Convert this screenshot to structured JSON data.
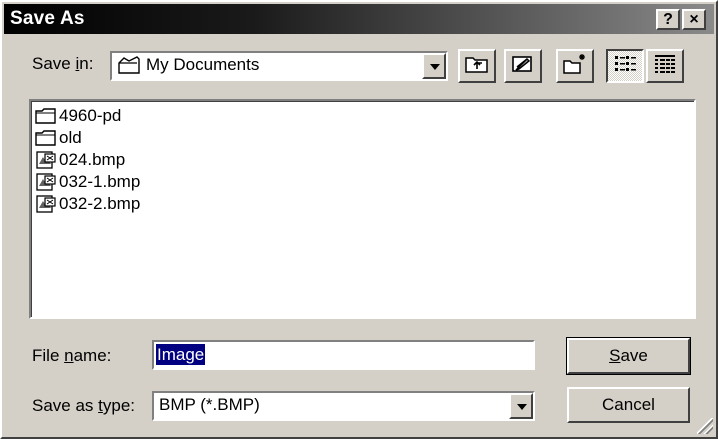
{
  "window": {
    "title": "Save As"
  },
  "titlebar": {
    "help_label": "?",
    "close_label": "×"
  },
  "save_in": {
    "label_pre": "Save ",
    "label_hot": "i",
    "label_post": "n:",
    "value": "My Documents",
    "icon": "folder-icon"
  },
  "toolbar": [
    {
      "name": "up-one-level-button",
      "icon": "up-folder-icon"
    },
    {
      "name": "desktop-button",
      "icon": "desktop-icon"
    },
    {
      "name": "new-folder-button",
      "icon": "new-folder-icon"
    },
    {
      "name": "list-view-button",
      "icon": "list-view-icon",
      "pressed": true
    },
    {
      "name": "details-view-button",
      "icon": "details-view-icon"
    }
  ],
  "files": [
    {
      "name": "4960-pd",
      "type": "folder"
    },
    {
      "name": "old",
      "type": "folder"
    },
    {
      "name": "024.bmp",
      "type": "bitmap"
    },
    {
      "name": "032-1.bmp",
      "type": "bitmap"
    },
    {
      "name": "032-2.bmp",
      "type": "bitmap"
    }
  ],
  "file_name": {
    "label_pre": "File ",
    "label_hot": "n",
    "label_post": "ame:",
    "value": "Image"
  },
  "save_as_type": {
    "label_pre": "Save as ",
    "label_hot": "t",
    "label_post": "ype:",
    "value": "BMP (*.BMP)"
  },
  "buttons": {
    "save_hot": "S",
    "save_rest": "ave",
    "cancel": "Cancel"
  },
  "colors": {
    "selection": "#000080",
    "face": "#d4d0c8"
  }
}
